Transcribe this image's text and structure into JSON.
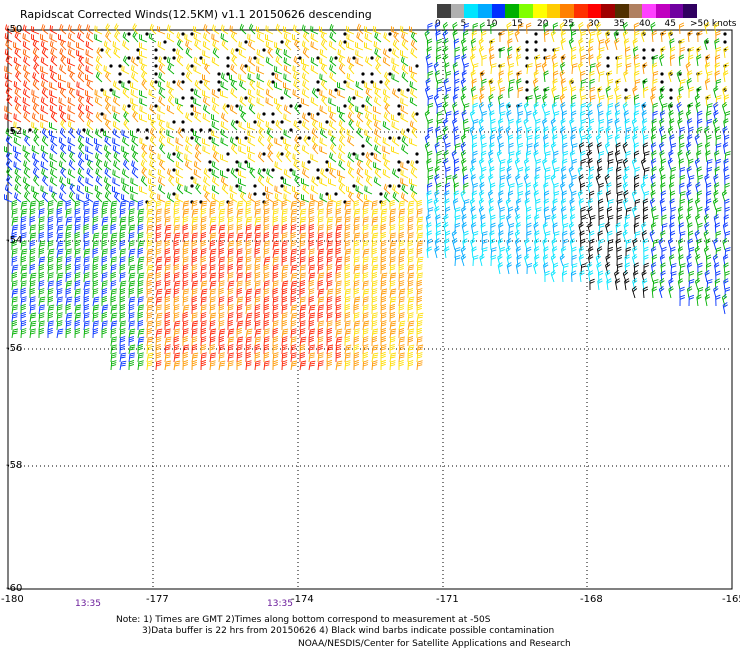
{
  "header": {
    "title": "Rapidscat Corrected Winds(12.5KM) v1.1 20150626 descending"
  },
  "legend": {
    "colors": [
      "#404040",
      "#b0b0b0",
      "#00e5ff",
      "#00aaff",
      "#0030ff",
      "#00b000",
      "#80ff00",
      "#ffff00",
      "#ffcc00",
      "#ff8000",
      "#ff3000",
      "#ff0000",
      "#a00000",
      "#503000",
      "#b08060",
      "#ff40ff",
      "#c000c0",
      "#7000a0",
      "#300060"
    ],
    "labels": [
      "0",
      "5",
      "10",
      "15",
      "20",
      "25",
      "30",
      "35",
      "40",
      "45",
      ">50 knots"
    ]
  },
  "map": {
    "longitudes": [
      "-180",
      "-177",
      "-174",
      "-171",
      "-168",
      "-165"
    ],
    "latitudes": [
      "-50",
      "-52",
      "-54",
      "-56",
      "-58",
      "-60"
    ],
    "times": [
      "13:35",
      "13:35"
    ]
  },
  "notes": {
    "line1": "Note: 1) Times are GMT 2)Times along bottom correspond to measurement at -50S",
    "line2": "3)Data buffer is 22 hrs from 20150626 4) Black wind barbs indicate possible contamination",
    "credit": "NOAA/NESDIS/Center for Satellite Applications and Research"
  }
}
